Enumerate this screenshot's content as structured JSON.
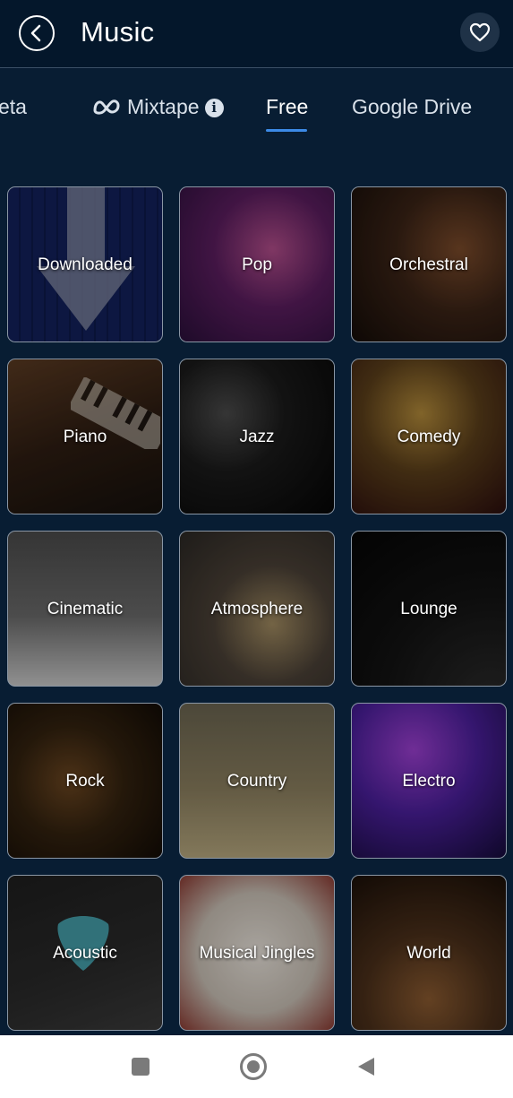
{
  "header": {
    "title": "Music",
    "back_icon": "chevron-left-circle-icon",
    "favorite_icon": "heart-icon"
  },
  "tabs": [
    {
      "label": "eta"
    },
    {
      "label": "Mixtape",
      "icon": "meta-infinity-icon",
      "info_icon": "info-icon",
      "info_glyph": "i"
    },
    {
      "label": "Free",
      "selected": true
    },
    {
      "label": "Google Drive"
    }
  ],
  "accent_color": "#3c8ae6",
  "background_color": "#081d33",
  "categories": [
    {
      "label": "Downloaded"
    },
    {
      "label": "Pop"
    },
    {
      "label": "Orchestral"
    },
    {
      "label": "Piano"
    },
    {
      "label": "Jazz"
    },
    {
      "label": "Comedy"
    },
    {
      "label": "Cinematic"
    },
    {
      "label": "Atmosphere"
    },
    {
      "label": "Lounge"
    },
    {
      "label": "Rock"
    },
    {
      "label": "Country"
    },
    {
      "label": "Electro"
    },
    {
      "label": "Acoustic"
    },
    {
      "label": "Musical Jingles"
    },
    {
      "label": "World"
    }
  ],
  "system_nav": {
    "recents_icon": "square-icon",
    "home_icon": "home-circle-icon",
    "back_icon": "triangle-back-icon"
  }
}
